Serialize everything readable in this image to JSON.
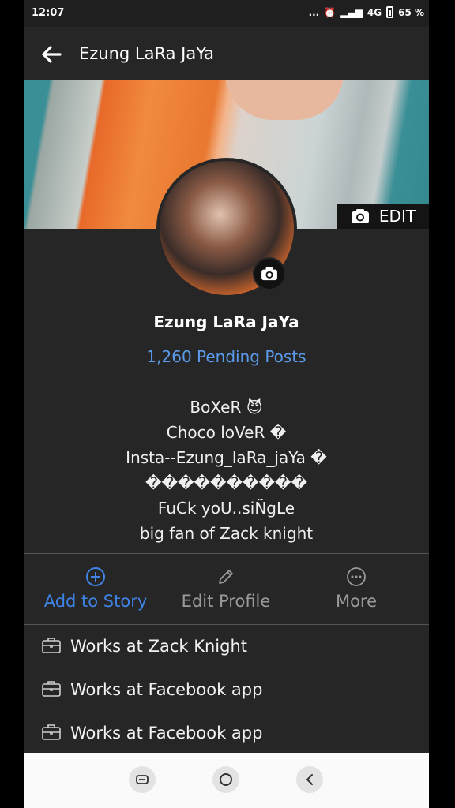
{
  "status_bar": {
    "time": "12:07",
    "indicators": "... ",
    "network": "4G",
    "battery": "65 %"
  },
  "header": {
    "title": "Ezung LaRa JaYa"
  },
  "cover": {
    "edit_label": "EDIT"
  },
  "profile": {
    "name": "Ezung LaRa JaYa",
    "pending_posts": "1,260 Pending Posts"
  },
  "bio": {
    "lines": [
      "BoXeR 😈",
      "Choco loVeR �",
      "Insta--Ezung_laRa_jaYa �",
      "����������",
      "FuCk yoU..siÑgLe",
      "big fan of Zack knight"
    ]
  },
  "actions": {
    "add_to_story": "Add to Story",
    "edit_profile": "Edit Profile",
    "more": "More"
  },
  "work": [
    {
      "label": "Works at Zack Knight"
    },
    {
      "label": "Works at Facebook app"
    },
    {
      "label": "Works at Facebook app"
    }
  ],
  "colors": {
    "accent": "#3f83e6",
    "link": "#5b9bec",
    "background": "#262626"
  }
}
